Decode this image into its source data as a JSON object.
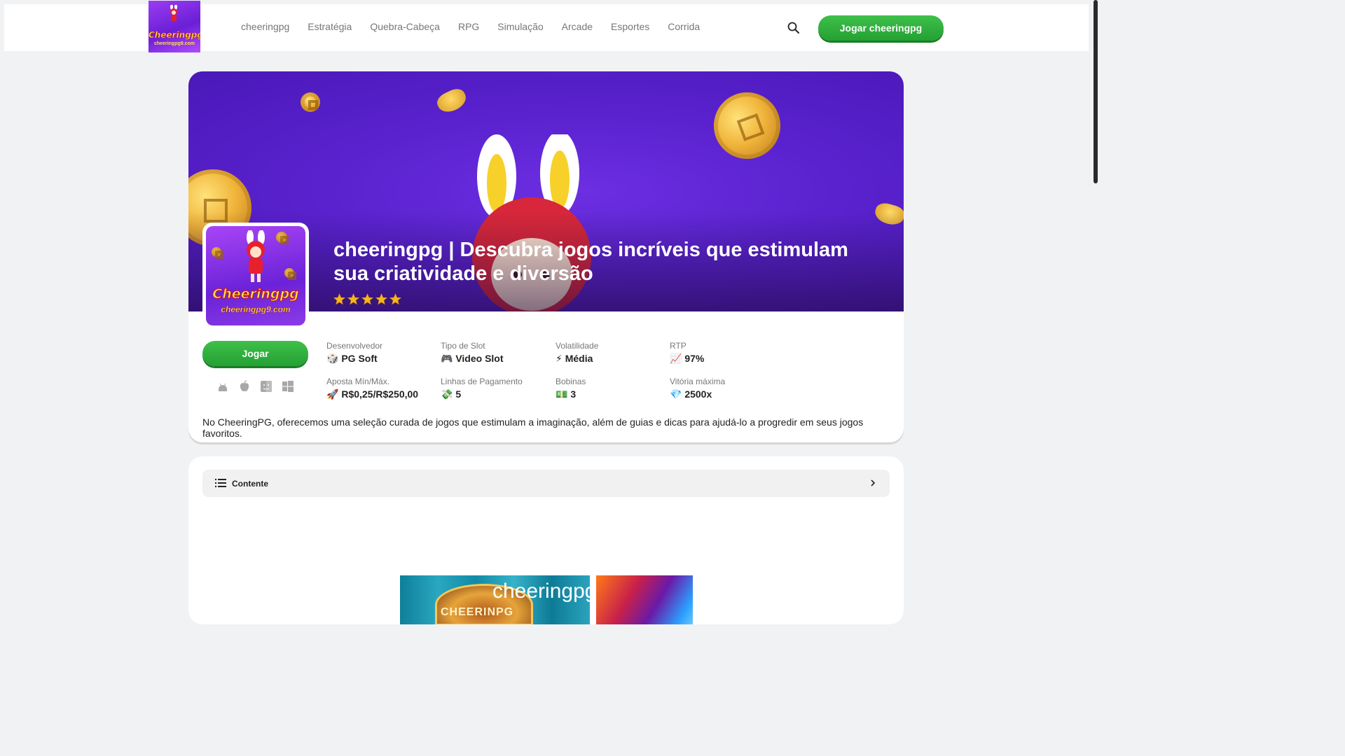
{
  "header": {
    "logo": {
      "text": "Cheeringpg",
      "url": "cheeringpg9.com"
    },
    "nav": [
      "cheeringpg",
      "Estratégia",
      "Quebra-Cabeça",
      "RPG",
      "Simulação",
      "Arcade",
      "Esportes",
      "Corrida"
    ],
    "cta_label": "Jogar cheeringpg"
  },
  "hero": {
    "title": "cheeringpg | Descubra jogos incríveis que estimulam sua criatividade e diversão",
    "rating": 5,
    "thumb": {
      "text": "Cheeringpg",
      "url": "cheeringpg9.com"
    },
    "play_label": "Jogar",
    "platforms": [
      "android-icon",
      "apple-icon",
      "finder-icon",
      "windows-icon"
    ],
    "specs": [
      {
        "label": "Desenvolvedor",
        "emoji": "🎲",
        "value": "PG Soft"
      },
      {
        "label": "Tipo de Slot",
        "emoji": "🎮",
        "value": "Video Slot"
      },
      {
        "label": "Volatilidade",
        "emoji": "⚡",
        "value": "Média"
      },
      {
        "label": "RTP",
        "emoji": "📈",
        "value": "97%"
      },
      {
        "label": "Aposta Mín/Máx.",
        "emoji": "🚀",
        "value": "R$0,25/R$250,00"
      },
      {
        "label": "Linhas de Pagamento",
        "emoji": "💸",
        "value": "5"
      },
      {
        "label": "Bobinas",
        "emoji": "💵",
        "value": "3"
      },
      {
        "label": "Vitória máxima",
        "emoji": "💎",
        "value": "2500x"
      }
    ],
    "intro": "No CheeringPG, oferecemos uma seleção curada de jogos que estimulam a imaginação, além de guias e dicas para ajudá-lo a progredir em seus jogos favoritos."
  },
  "content": {
    "toc_label": "Contente",
    "image_overlay_text": "cheeringpg",
    "image_badge_text": "CHEERINPG"
  },
  "colors": {
    "brand_green": "#2fb03d",
    "banner_purple": "#5a22cf"
  }
}
